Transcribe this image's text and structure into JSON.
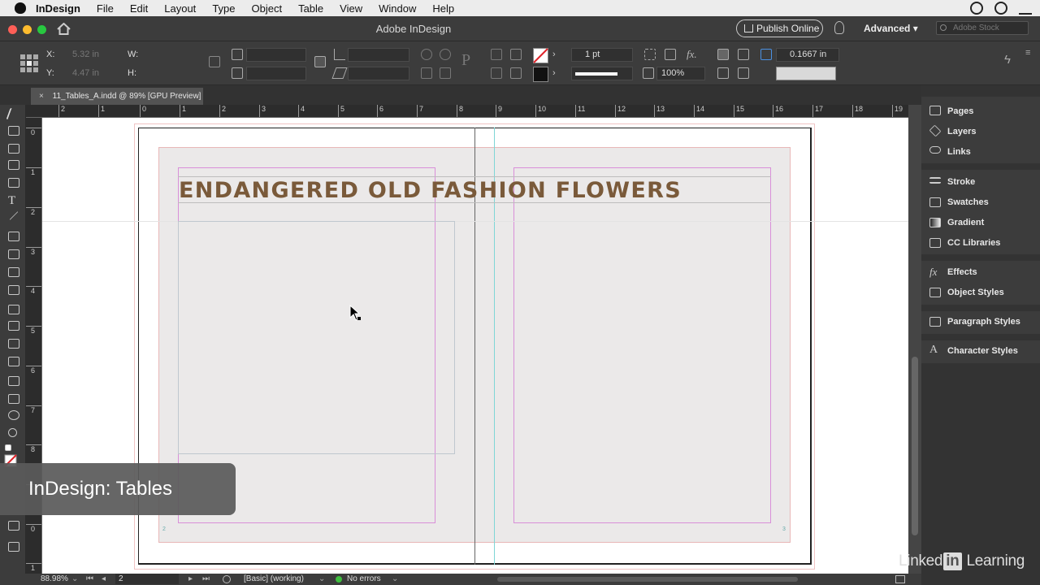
{
  "menubar": {
    "app": "InDesign",
    "items": [
      "File",
      "Edit",
      "Layout",
      "Type",
      "Object",
      "Table",
      "View",
      "Window",
      "Help"
    ]
  },
  "titlebar": {
    "title": "Adobe InDesign",
    "publish_label": "Publish Online",
    "workspace": "Advanced",
    "search_placeholder": "Adobe Stock"
  },
  "control": {
    "x_label": "X:",
    "x_value": "5.32 in",
    "y_label": "Y:",
    "y_value": "4.47 in",
    "w_label": "W:",
    "h_label": "H:",
    "stroke_weight": "1 pt",
    "opacity": "100%",
    "offset_value": "0.1667 in"
  },
  "document_tab": {
    "title": "11_Tables_A.indd @ 89% [GPU Preview]"
  },
  "rulers": {
    "horizontal": [
      "2",
      "1",
      "0",
      "1",
      "2",
      "3",
      "4",
      "5",
      "6",
      "7",
      "8",
      "9",
      "10",
      "11",
      "12",
      "13",
      "14",
      "15",
      "16",
      "17",
      "18",
      "19"
    ],
    "vertical": [
      "0",
      "1",
      "2",
      "3",
      "4",
      "5",
      "6",
      "7",
      "8",
      "9",
      "0",
      "1"
    ]
  },
  "page": {
    "heading": "ENDANGERED OLD FASHION FLOWERS",
    "heading_color": "#7a5a3a",
    "left_folio": "2",
    "right_folio": "3"
  },
  "panels": {
    "groups": [
      [
        "Pages",
        "Layers",
        "Links"
      ],
      [
        "Stroke",
        "Swatches",
        "Gradient",
        "CC Libraries"
      ],
      [
        "Effects",
        "Object Styles"
      ],
      [
        "Paragraph Styles"
      ],
      [
        "Character Styles"
      ]
    ]
  },
  "status": {
    "zoom": "88.98%",
    "page_number": "2",
    "preflight_profile": "[Basic] (working)",
    "errors": "No errors"
  },
  "overlay": {
    "course_title": "InDesign: Tables"
  },
  "brand": {
    "prefix": "Linked",
    "in": "in",
    "suffix": "Learning"
  }
}
